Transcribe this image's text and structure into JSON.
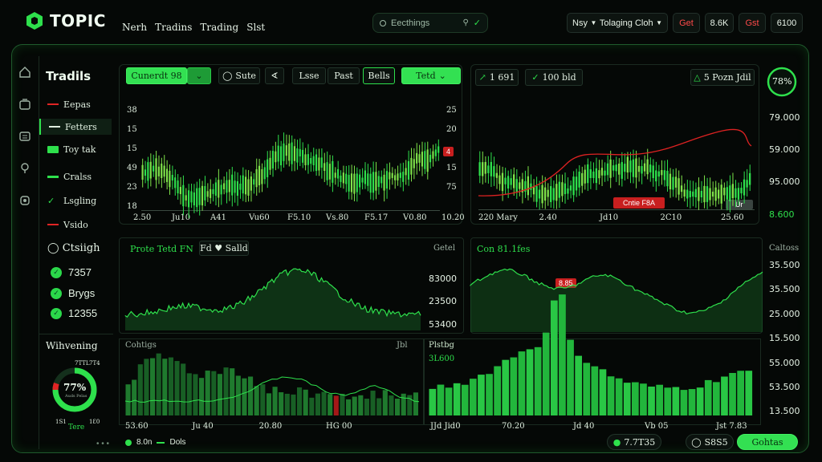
{
  "brand": {
    "name": "TOPIC",
    "accent": "#2ee04c"
  },
  "topnav": [
    "Nerh",
    "Tradins",
    "Trading",
    "Slst"
  ],
  "search": {
    "placeholder": "Eecthings"
  },
  "top_right": {
    "dropdown1": "Nsy",
    "dropdown2": "Tolaging Cloh",
    "btn1": "Get",
    "btn2": "8.6K",
    "btn3": "Gst",
    "btn4": "6100"
  },
  "sidebar": {
    "title": "Tradils",
    "items": [
      {
        "label": "Eepas",
        "color": "#e02424",
        "kind": "line"
      },
      {
        "label": "Fetters",
        "color": "#dfeedf",
        "kind": "line",
        "active": true
      },
      {
        "label": "Toy tak",
        "color": "#2ee04c",
        "kind": "box"
      },
      {
        "label": "Cralss",
        "color": "#2ee04c",
        "kind": "line"
      },
      {
        "label": "Lsgling",
        "color": "#2ee04c",
        "kind": "check"
      },
      {
        "label": "Vsido",
        "color": "#e02424",
        "kind": "line"
      }
    ],
    "section": "Ctsiigh",
    "stats": [
      {
        "value": "7357"
      },
      {
        "value": "Brygs"
      },
      {
        "value": "12355"
      }
    ],
    "gauge_title": "Wihvening",
    "gauge": {
      "value_text": "77%",
      "sub": "Auds Pelas",
      "left_top": "7TTL",
      "right_top": "7T4",
      "left_bottom": "1S1",
      "right_bottom": "1Ɛ0",
      "foot": "Tere",
      "percent": 77
    }
  },
  "main_chart": {
    "tabs": [
      "Cunerdt 98",
      "Sute",
      "Lsse",
      "Past",
      "Bells",
      "Tetd"
    ],
    "y_left": [
      "38",
      "15",
      "15",
      "49",
      "23",
      "18"
    ],
    "y_right": [
      "25",
      "20",
      "15",
      "75"
    ],
    "x": [
      "2.50",
      "Ju10",
      "A41",
      "Vu60",
      "F5.10",
      "Vs.80",
      "F5.17",
      "V0.80",
      "10.20"
    ],
    "price_badge": "4"
  },
  "right_chart": {
    "tabs": [
      "1 691",
      "100 bld"
    ],
    "info": "5 Pozn Jdil",
    "gauge": "78%",
    "y": [
      "79.000",
      "59.000",
      "95.000",
      "8.600"
    ],
    "x": [
      "220 Mary",
      "2.40",
      "Jd10",
      "2C10",
      "25.60"
    ],
    "label_red": "Cntie F8A",
    "label_gray": "Ur"
  },
  "mid_left": {
    "title": "Prote Tetd FN",
    "tag": "Fd ♥ Salld",
    "label": "Getel",
    "y": [
      "83000",
      "23500",
      "53400"
    ]
  },
  "mid_right": {
    "title": "Con 81.1fes",
    "label": "Caltoss",
    "badge": "8.85",
    "y": [
      "35.500",
      "35.500",
      "25.000",
      "15.500"
    ]
  },
  "bottom_left": {
    "label_l": "Cohtigs",
    "label_r": "Jbl",
    "x": [
      "53.60",
      "Ju 40",
      "20.80",
      "HG 00"
    ]
  },
  "bottom_right": {
    "label": "Plstbg",
    "value": "3L600",
    "y": [
      "55.000",
      "53.500",
      "13.500",
      "13.500"
    ],
    "x": [
      "JJd Jid0",
      "70.20",
      "Jd 40",
      "Vb 05",
      "Jst 7.83"
    ]
  },
  "footer": {
    "dots": "• • •",
    "legend1": "8.0n",
    "legend2": "Dols",
    "btn1": "7.7T35",
    "btn2": "S8S5",
    "btn3": "Gohtas"
  }
}
